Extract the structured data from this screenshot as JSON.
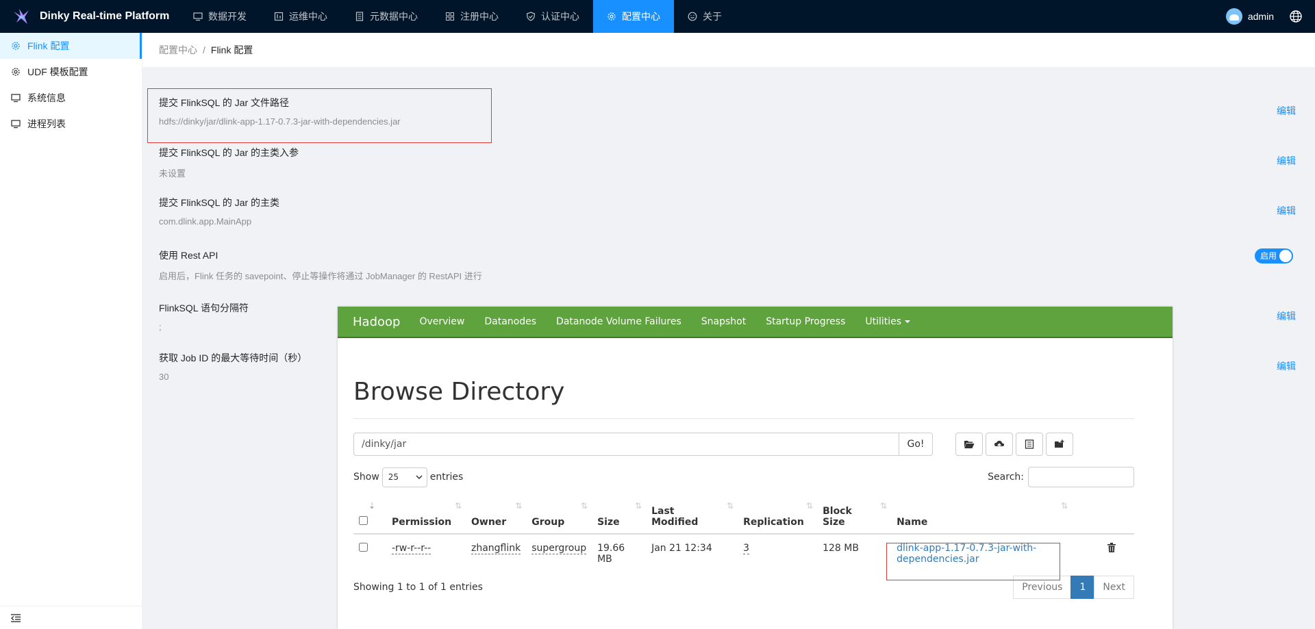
{
  "app": {
    "title": "Dinky Real-time Platform"
  },
  "topnav": {
    "items": [
      {
        "label": "数据开发",
        "icon": "monitor-icon"
      },
      {
        "label": "运维中心",
        "icon": "dashboard-icon"
      },
      {
        "label": "元数据中心",
        "icon": "database-icon"
      },
      {
        "label": "注册中心",
        "icon": "appstore-icon"
      },
      {
        "label": "认证中心",
        "icon": "shield-icon"
      },
      {
        "label": "配置中心",
        "icon": "gear-icon",
        "active": true
      },
      {
        "label": "关于",
        "icon": "smile-icon"
      }
    ],
    "user": "admin"
  },
  "sidebar": {
    "items": [
      {
        "label": "Flink 配置",
        "icon": "gear-icon",
        "active": true
      },
      {
        "label": "UDF 模板配置",
        "icon": "gear-icon"
      },
      {
        "label": "系统信息",
        "icon": "desktop-icon"
      },
      {
        "label": "进程列表",
        "icon": "desktop-icon"
      }
    ]
  },
  "breadcrumb": {
    "parent": "配置中心",
    "separator": "/",
    "current": "Flink 配置"
  },
  "settings": [
    {
      "title": "提交 FlinkSQL 的 Jar 文件路径",
      "value": "hdfs://dinky/jar/dlink-app-1.17-0.7.3-jar-with-dependencies.jar",
      "action": "编辑"
    },
    {
      "title": "提交 FlinkSQL 的 Jar 的主类入参",
      "value": "未设置",
      "action": "编辑"
    },
    {
      "title": "提交 FlinkSQL 的 Jar 的主类",
      "value": "com.dlink.app.MainApp",
      "action": "编辑"
    },
    {
      "title": "使用 Rest API",
      "value": "启用后，Flink 任务的 savepoint、停止等操作将通过 JobManager 的 RestAPI 进行",
      "toggle": "启用",
      "toggle_on": true
    },
    {
      "title": "FlinkSQL 语句分隔符",
      "value": ";",
      "action": "编辑"
    },
    {
      "title": "获取 Job ID 的最大等待时间（秒）",
      "value": "30",
      "action": "编辑"
    }
  ],
  "hadoop": {
    "brand": "Hadoop",
    "nav": [
      "Overview",
      "Datanodes",
      "Datanode Volume Failures",
      "Snapshot",
      "Startup Progress",
      "Utilities"
    ],
    "heading": "Browse Directory",
    "path": "/dinky/jar",
    "go_label": "Go!",
    "show_label": "Show",
    "entries_label": "entries",
    "page_size": "25",
    "search_label": "Search:",
    "columns": [
      "Permission",
      "Owner",
      "Group",
      "Size",
      "Last Modified",
      "Replication",
      "Block Size",
      "Name"
    ],
    "rows": [
      {
        "permission": "-rw-r--r--",
        "owner": "zhangflink",
        "group": "supergroup",
        "size": "19.66 MB",
        "modified": "Jan 21 12:34",
        "replication": "3",
        "block_size": "128 MB",
        "name": "dlink-app-1.17-0.7.3-jar-with-dependencies.jar"
      }
    ],
    "footer": "Showing 1 to 1 of 1 entries",
    "pager": {
      "prev": "Previous",
      "page": "1",
      "next": "Next"
    }
  },
  "colors": {
    "topbar": "#001529",
    "accent": "#1890ff",
    "hadoop_green": "#5fa33e",
    "highlight_box": "#e53935"
  }
}
